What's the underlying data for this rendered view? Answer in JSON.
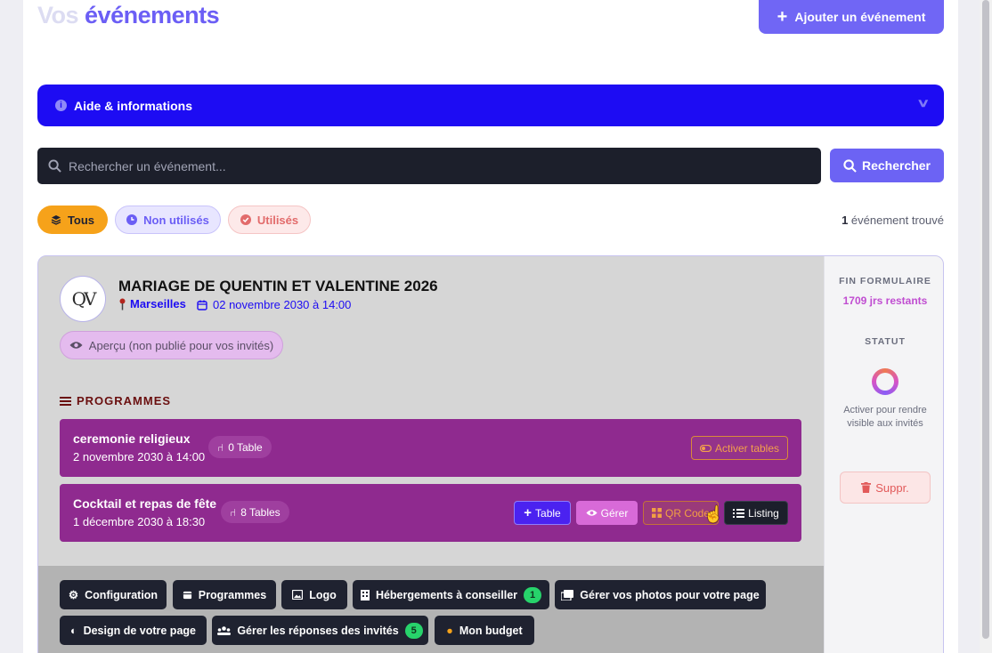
{
  "header": {
    "title_part1": "Vos",
    "title_part2": "événements",
    "add_label": "Ajouter un événement"
  },
  "help": {
    "label": "Aide & informations"
  },
  "search": {
    "placeholder": "Rechercher un événement...",
    "button_label": "Rechercher"
  },
  "filters": {
    "all": "Tous",
    "unused": "Non utilisés",
    "used": "Utilisés",
    "found_count": "1",
    "found_text": "événement trouvé"
  },
  "event": {
    "monogram": "QV",
    "title": "MARIAGE DE QUENTIN ET VALENTINE 2026",
    "location": "Marseilles",
    "date": "02 novembre 2030 à 14:00",
    "preview_label": "Aperçu (non publié pour vos invités)",
    "programs_title": "PROGRAMMES",
    "programs": [
      {
        "name": "ceremonie religieux",
        "when": "2 novembre 2030 à 14:00",
        "tables": "0 Table",
        "activate_label": "Activer tables"
      },
      {
        "name": "Cocktail et repas de fête",
        "when": "1 décembre 2030 à 18:30",
        "tables": "8 Tables",
        "table_btn": "Table",
        "manage_btn": "Gérer",
        "qr_btn": "QR Code",
        "listing_btn": "Listing"
      }
    ],
    "actions": {
      "configuration": "Configuration",
      "programmes": "Programmes",
      "logo": "Logo",
      "hebergements": "Hébergements à conseiller",
      "hebergements_count": "1",
      "photos": "Gérer vos photos pour votre page",
      "design": "Design de votre page",
      "reponses": "Gérer les réponses des invités",
      "reponses_count": "5",
      "budget": "Mon budget"
    }
  },
  "sidebar": {
    "form_end_title": "FIN FORMULAIRE",
    "days_remaining": "1709 jrs restants",
    "status_title": "STATUT",
    "activate_text": "Activer pour rendre visible aux invités",
    "delete_label": "Suppr."
  },
  "colors": {
    "accent": "#6b5ef5",
    "help_bar": "#1d0cf3",
    "program_bg": "#8f2a8f",
    "filter_all": "#f6a21a"
  }
}
